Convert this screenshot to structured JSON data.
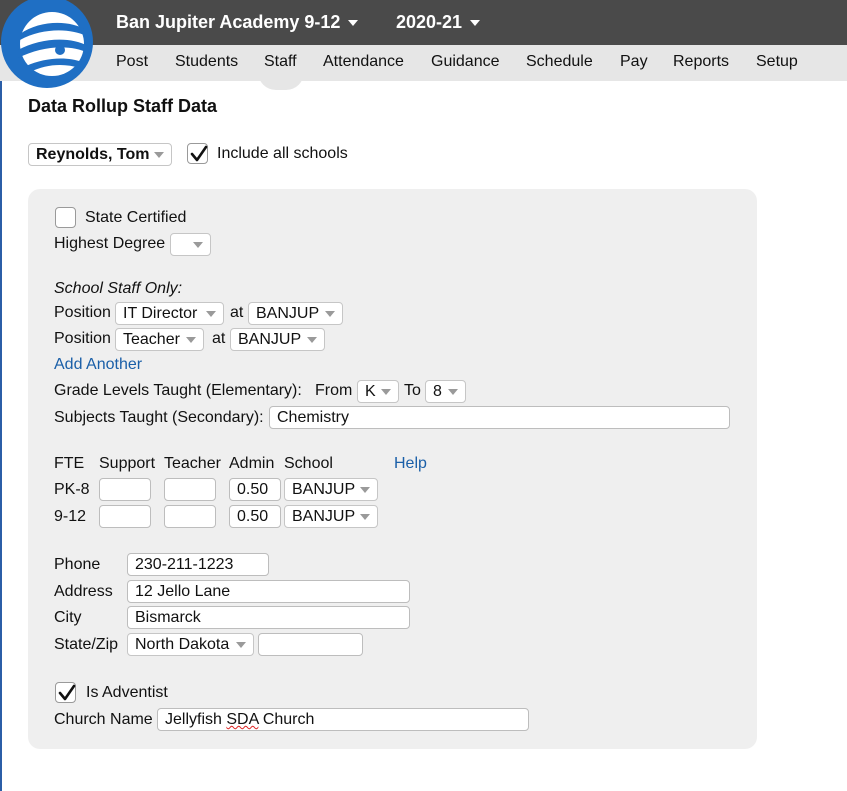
{
  "header": {
    "school": "Ban Jupiter Academy 9-12",
    "year": "2020-21"
  },
  "nav": [
    "Post",
    "Students",
    "Staff",
    "Attendance",
    "Guidance",
    "Schedule",
    "Pay",
    "Reports",
    "Setup"
  ],
  "page_title": "Data Rollup Staff Data",
  "staff_select": "Reynolds, Tom",
  "include_all_schools": {
    "label": "Include all schools",
    "checked": true
  },
  "state_certified": {
    "label": "State Certified",
    "checked": false
  },
  "highest_degree": {
    "label": "Highest Degree",
    "value": ""
  },
  "school_staff_only": "School Staff Only:",
  "positions": [
    {
      "label": "Position",
      "value": "IT Director",
      "at": "at",
      "school": "BANJUP"
    },
    {
      "label": "Position",
      "value": "Teacher",
      "at": "at",
      "school": "BANJUP"
    }
  ],
  "add_another": "Add Another",
  "grade_levels": {
    "label": "Grade Levels Taught (Elementary):",
    "from_label": "From",
    "from": "K",
    "to_label": "To",
    "to": "8"
  },
  "subjects": {
    "label": "Subjects Taught (Secondary):",
    "value": "Chemistry"
  },
  "fte": {
    "headers": [
      "FTE",
      "Support",
      "Teacher",
      "Admin",
      "School"
    ],
    "help": "Help",
    "rows": [
      {
        "label": "PK-8",
        "support": "",
        "teacher": "",
        "admin": "0.50",
        "school": "BANJUP"
      },
      {
        "label": "9-12",
        "support": "",
        "teacher": "",
        "admin": "0.50",
        "school": "BANJUP"
      }
    ]
  },
  "contact": {
    "phone_label": "Phone",
    "phone": "230-211-1223",
    "address_label": "Address",
    "address": "12 Jello Lane",
    "city_label": "City",
    "city": "Bismarck",
    "state_zip_label": "State/Zip",
    "state": "North Dakota",
    "zip": ""
  },
  "is_adventist": {
    "label": "Is Adventist",
    "checked": true
  },
  "church": {
    "label": "Church Name",
    "value_start": "Jellyfish ",
    "value_misspelled": "SDA",
    "value_end": " Church"
  },
  "colors": {
    "topbar": "#4a4a4a",
    "navbar": "#e6e6e6",
    "link": "#1a5fa8",
    "logo": "#1f6fc4",
    "panel": "#efefef"
  }
}
